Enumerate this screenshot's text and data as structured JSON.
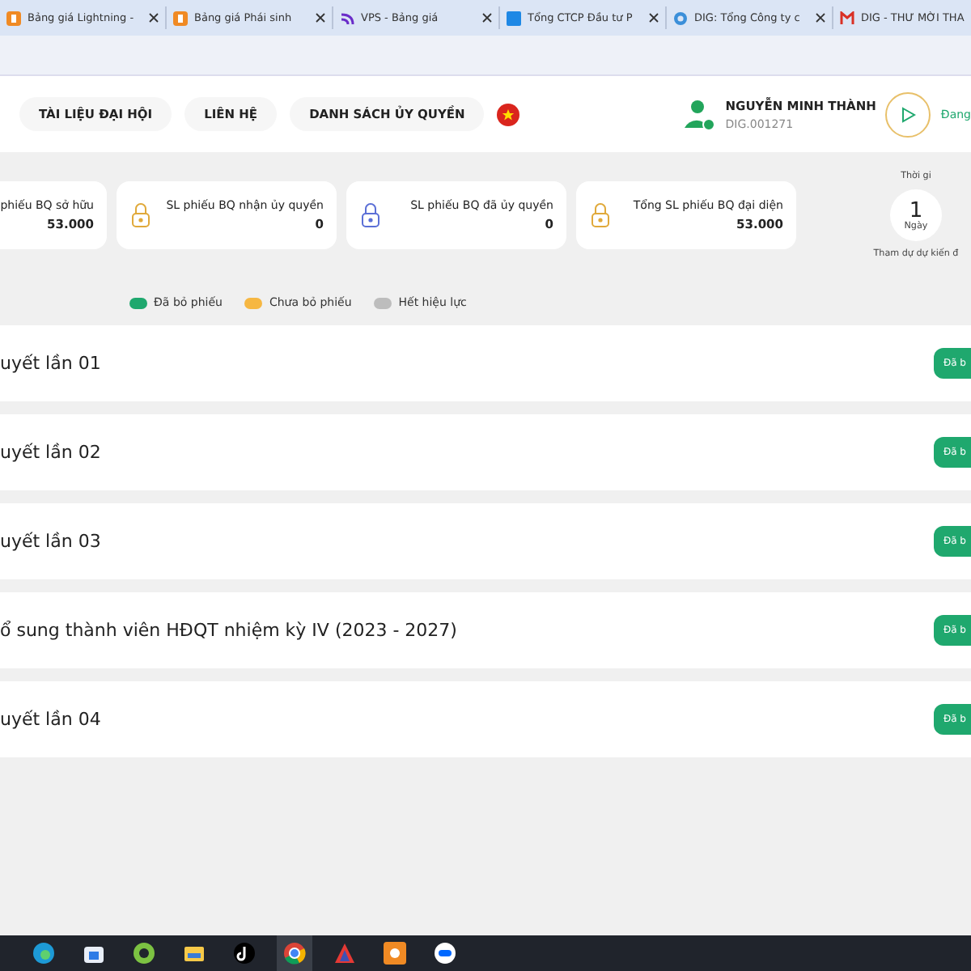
{
  "browser_tabs": [
    {
      "title": "Bảng giá Lightning -",
      "kind": "orange"
    },
    {
      "title": "Bảng giá Phái sinh",
      "kind": "orange"
    },
    {
      "title": "VPS - Bảng giá",
      "kind": "purple"
    },
    {
      "title": "Tổng CTCP Đầu tư P",
      "kind": "blue"
    },
    {
      "title": "DIG: Tổng Công ty c",
      "kind": "globe"
    },
    {
      "title": "DIG - THƯ MỜI THA",
      "kind": "mail"
    }
  ],
  "nav": [
    "TÀI LIỆU ĐẠI HỘI",
    "LIÊN HỆ",
    "DANH SÁCH ỦY QUYỀN"
  ],
  "user": {
    "name": "NGUYỄN MINH THÀNH",
    "code": "DIG.001271"
  },
  "join_button": {
    "label": "Đang"
  },
  "stats": [
    {
      "label": "phiếu BQ sở hữu",
      "value": "53.000"
    },
    {
      "label": "SL phiếu BQ nhận ủy quyền",
      "value": "0",
      "color": "#e0a93a"
    },
    {
      "label": "SL phiếu BQ đã ủy quyền",
      "value": "0",
      "color": "#5b6fd6"
    },
    {
      "label": "Tổng SL phiếu BQ đại diện",
      "value": "53.000",
      "color": "#e0a93a"
    }
  ],
  "countdown": {
    "title": "Thời gi",
    "number": "1",
    "unit": "Ngày",
    "caption": "Tham dự dự kiến đ"
  },
  "legend": [
    {
      "label": "Đã bỏ phiếu",
      "color": "#1fa86e"
    },
    {
      "label": "Chưa bỏ phiếu",
      "color": "#f6b742"
    },
    {
      "label": "Hết hiệu lực",
      "color": "#bdbdbd"
    }
  ],
  "resolutions": [
    {
      "title": "uyết lần 01",
      "status": "Đã b",
      "color": "#1fa86e"
    },
    {
      "title": "uyết lần 02",
      "status": "Đã b",
      "color": "#1fa86e"
    },
    {
      "title": "uyết lần 03",
      "status": "Đã b",
      "color": "#1fa86e"
    },
    {
      "title": "ổ sung thành viên HĐQT nhiệm kỳ IV (2023 - 2027)",
      "status": "Đã b",
      "color": "#1fa86e"
    },
    {
      "title": "uyết lần 04",
      "status": "Đã b",
      "color": "#1fa86e"
    }
  ],
  "taskbar": [
    {
      "kind": "edge",
      "selected": false
    },
    {
      "kind": "store",
      "selected": false
    },
    {
      "kind": "ring",
      "selected": false
    },
    {
      "kind": "folder",
      "selected": false
    },
    {
      "kind": "note",
      "selected": false
    },
    {
      "kind": "chrome",
      "selected": true
    },
    {
      "kind": "triangle",
      "selected": false
    },
    {
      "kind": "orange",
      "selected": false
    },
    {
      "kind": "chat",
      "selected": false
    }
  ]
}
